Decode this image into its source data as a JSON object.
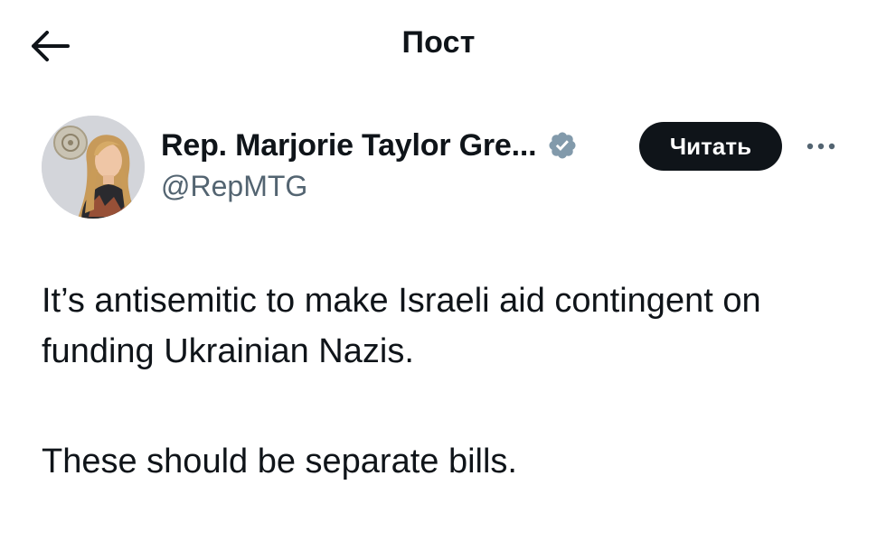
{
  "header": {
    "title": "Пост"
  },
  "author": {
    "display_name": "Rep. Marjorie Taylor Gre...",
    "handle": "@RepMTG",
    "verified": true,
    "follow_label": "Читать"
  },
  "tweet": {
    "paragraphs": [
      "It’s antisemitic to make Israeli aid contingent on funding Ukrainian Nazis.",
      "These should be separate bills."
    ]
  },
  "colors": {
    "text": "#0f1419",
    "secondary_text": "#536471",
    "verified_badge": "#829aab",
    "button_bg": "#0f1419"
  },
  "icons": {
    "back": "arrow-left-icon",
    "verified": "verified-badge-icon",
    "more": "more-horizontal-icon"
  }
}
